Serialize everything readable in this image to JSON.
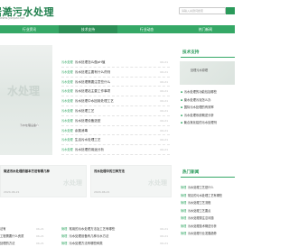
{
  "header": {
    "logo": "岩澔污水处理",
    "logo_sub": "www.yunpai.net",
    "search_placeholder": "请输入关键词搜索"
  },
  "nav": [
    "行业资讯",
    "技术支持",
    "行业动态",
    "热门新闻"
  ],
  "left_banner": {
    "watermark": "水处理",
    "caption": "污水处理设备介"
  },
  "news_list": [
    {
      "tag": "污水处理",
      "title": "污水处理怎么做pH值",
      "date": "06-21"
    },
    {
      "tag": "污水处理",
      "title": "污水处理主要有什么药剂",
      "date": "06-21"
    },
    {
      "tag": "污水处理",
      "title": "污水处理需要注意些什么",
      "date": "06-21"
    },
    {
      "tag": "污水处理",
      "title": "污水处理站主要工作事项",
      "date": "06-21"
    },
    {
      "tag": "污水处理",
      "title": "污水处理中水回用处理工艺",
      "date": "06-21"
    },
    {
      "tag": "污水处理",
      "title": "污水处理工艺",
      "date": "06-21"
    },
    {
      "tag": "污水处理",
      "title": "污水处理设备选型",
      "date": "06-21"
    },
    {
      "tag": "污水处理",
      "title": "余氯消毒",
      "date": "06-21"
    },
    {
      "tag": "污水处理",
      "title": "生活污水处理工艺",
      "date": "06-21"
    },
    {
      "tag": "污水处理",
      "title": "污水处理的用途分析",
      "date": "06-21"
    }
  ],
  "tech": {
    "title": "技术支持",
    "banner_caption": "处理污水原理",
    "items": [
      "污水处理的功能包括哪些",
      "废水处理污泥怎么办",
      "国际污水处理的有效率",
      "污水处理系统概述分析",
      "聚合氯化铝的污水处理剂"
    ]
  },
  "cards": [
    {
      "title": "简述污水处理的基本方法有哪几种",
      "date": "2024-06-21",
      "watermark": "水处理"
    },
    {
      "title": "污水处理中的三种方法",
      "date": "2024-06-21",
      "watermark": "水处理"
    }
  ],
  "hot": {
    "title": "热门新闻",
    "items": [
      {
        "k": "管理",
        "t": "污水处理工艺是什么"
      },
      {
        "k": "管理",
        "t": "常见的污水处理工艺有哪些"
      },
      {
        "k": "管理",
        "t": "污水处理工艺流程"
      },
      {
        "k": "管理",
        "t": "污水处理工艺要点"
      },
      {
        "k": "管理",
        "t": "污水处理需注意问题"
      },
      {
        "k": "管理",
        "t": "污水处理技术概述分析"
      },
      {
        "k": "管理",
        "t": "污水处理行业发展趋势"
      }
    ]
  },
  "bottom_left": [
    {
      "t": "法有",
      "d": "06-21"
    },
    {
      "t": "工程需要什么资质",
      "d": "06-21"
    },
    {
      "t": "处理的方法",
      "d": "06-21"
    },
    {
      "t": "的方法有",
      "d": "06-21"
    },
    {
      "t": "处理方法",
      "d": "06-21"
    }
  ],
  "bottom_mid": [
    {
      "k": "管理",
      "t": "常用的污水处理方法及工艺有哪些",
      "d": "06-21"
    },
    {
      "k": "管理",
      "t": "污水处理设备有几种污水方法",
      "d": "06-21"
    },
    {
      "k": "管理",
      "t": "污水处理方法有哪些种类",
      "d": "06-21"
    },
    {
      "k": "管理",
      "t": "工业废水处理工艺有哪些方式",
      "d": "06-21"
    },
    {
      "k": "管理",
      "t": "污水处理工艺主要流程之一",
      "d": "06-21"
    }
  ]
}
